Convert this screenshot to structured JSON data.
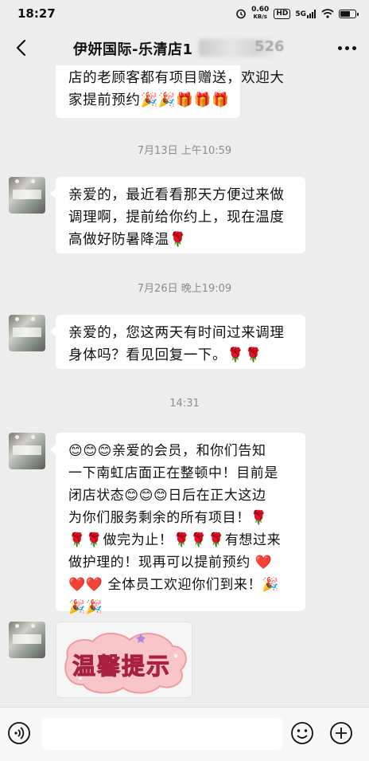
{
  "status_bar": {
    "time": "18:27",
    "net_speed": "0.60",
    "net_unit": "KB/s",
    "hd_badge": "HD",
    "signal": "5G",
    "battery_level": 0.7
  },
  "header": {
    "title": "伊妍国际-乐清店1",
    "title_suffix": "526"
  },
  "messages": [
    {
      "lines": [
        "店的老顾客都有项目赠送，欢迎大",
        "家提前预约🎉🎉🎁🎁🎁"
      ]
    },
    {
      "time": "7月13日 上午10:59",
      "lines": [
        "亲爱的，最近看看那天方便过来做",
        "调理啊，提前给你约上，现在温度",
        "高做好防暑降温🌹"
      ]
    },
    {
      "time": "7月26日 晚上19:09",
      "lines": [
        "亲爱的，您这两天有时间过来调理",
        "身体吗？看见回复一下。🌹🌹"
      ]
    },
    {
      "time": "14:31",
      "lines": [
        "😊😊😊亲爱的会员，和你们告知",
        "一下南虹店面正在整顿中！目前是",
        "闭店状态😊😊😊日后在正大这边",
        "为你们服务剩余的所有项目！🌹",
        "🌹🌹做完为止！🌹🌹🌹有想过来",
        "做护理的！现再可以提前预约 ❤️",
        "❤️❤️ 全体员工欢迎你们到来！🎉",
        "🎉🎉"
      ]
    },
    {
      "image_text": "温馨提示"
    }
  ],
  "input": {
    "placeholder": ""
  }
}
